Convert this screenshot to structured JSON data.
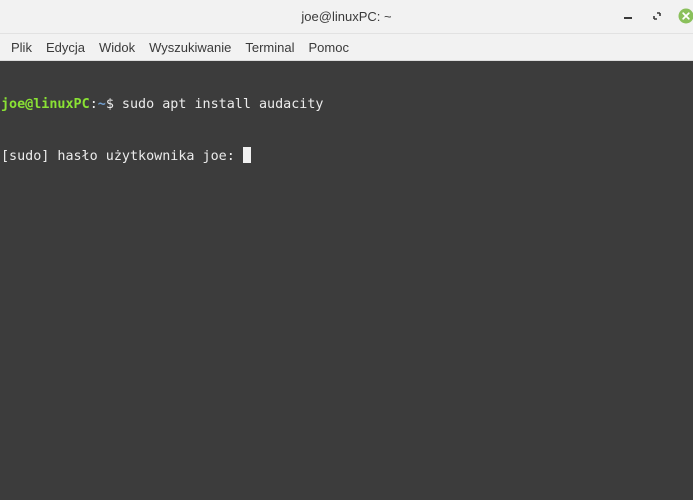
{
  "window": {
    "title": "joe@linuxPC: ~"
  },
  "window_controls": {
    "minimize_icon": "minimize-icon",
    "maximize_icon": "maximize-icon",
    "close_icon": "close-icon",
    "close_color": "#8ac05b"
  },
  "menu": {
    "items": [
      "Plik",
      "Edycja",
      "Widok",
      "Wyszukiwanie",
      "Terminal",
      "Pomoc"
    ]
  },
  "terminal": {
    "background": "#3c3c3c",
    "prompt_user_color": "#8ae234",
    "prompt_path_color": "#729fcf",
    "lines": [
      {
        "user_host": "joe@linuxPC",
        "separator": ":",
        "path": "~",
        "symbol": "$",
        "command": " sudo apt install audacity"
      },
      {
        "text": "[sudo] hasło użytkownika joe: "
      }
    ]
  }
}
